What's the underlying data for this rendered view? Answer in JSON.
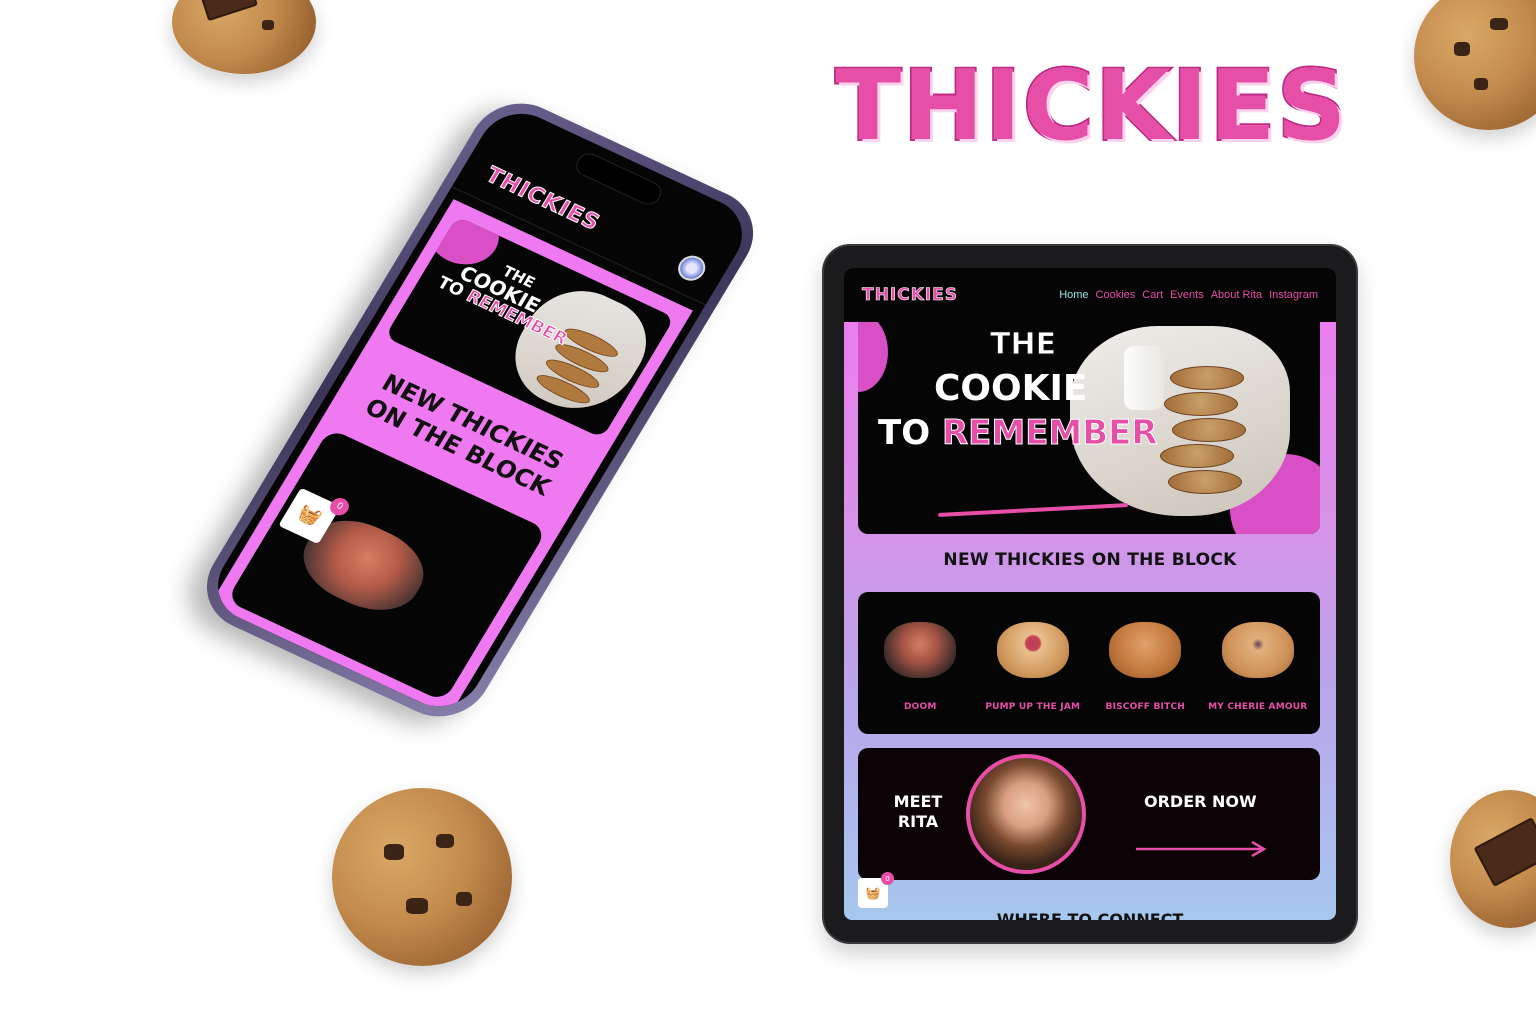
{
  "brand": {
    "wordmark": "THICKIES"
  },
  "phone": {
    "logo": "THICKIES",
    "hero": {
      "line1": "THE",
      "line2": "COOKIE",
      "line3_a": "TO",
      "line3_b": "REMEMBER"
    },
    "section_title": "NEW THICKIES ON THE BLOCK",
    "cart_count": "0"
  },
  "tablet": {
    "logo": "THICKIES",
    "nav": [
      "Home",
      "Cookies",
      "Cart",
      "Events",
      "About Rita",
      "Instagram"
    ],
    "nav_active": "Home",
    "hero": {
      "line1": "THE",
      "line2": "COOKIE",
      "line3_a": "TO",
      "line3_b": "REMEMBER"
    },
    "section_title": "NEW THICKIES ON THE BLOCK",
    "products": [
      {
        "name": "DOOM"
      },
      {
        "name": "PUMP UP THE JAM"
      },
      {
        "name": "BISCOFF BITCH"
      },
      {
        "name": "MY CHERIE AMOUR"
      }
    ],
    "meet": {
      "label": "MEET RITA"
    },
    "order": {
      "label": "ORDER NOW"
    },
    "cart_count": "0",
    "connect_title": "WHERE TO CONNECT"
  },
  "colors": {
    "brand_pink": "#e64ea8",
    "screen_black": "#050505",
    "nav_active": "#9be3e6",
    "gradient_top": "#ef79f0",
    "gradient_bottom": "#a6c8ee"
  }
}
